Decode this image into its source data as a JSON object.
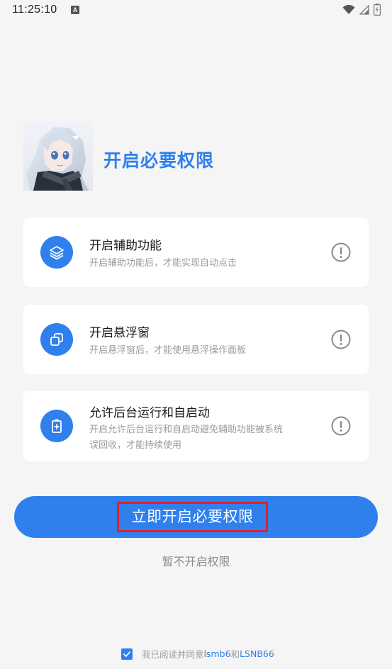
{
  "status_bar": {
    "time": "11:25:10",
    "notification_icon": "A"
  },
  "header": {
    "title": "开启必要权限"
  },
  "permissions": [
    {
      "title": "开启辅助功能",
      "description": "开启辅助功能后，才能实现自动点击",
      "icon": "layers-icon"
    },
    {
      "title": "开启悬浮窗",
      "description": "开启悬浮窗后，才能使用悬浮操作面板",
      "icon": "float-window-icon"
    },
    {
      "title": "允许后台运行和自启动",
      "description_line1": "开启允许后台运行和自启动避免辅助功能被系统",
      "description_line2": "误回收，才能持续使用",
      "icon": "battery-plus-icon"
    }
  ],
  "actions": {
    "primary_label": "立即开启必要权限",
    "skip_label": "暂不开启权限"
  },
  "agreement": {
    "prefix": "我已阅读并同意",
    "link1": "lsmb6",
    "joiner": "和",
    "link2": "LSNB66",
    "checked": true
  },
  "colors": {
    "accent": "#2f80ed",
    "background": "#f5f5f5",
    "highlight_border": "#e0202a"
  }
}
